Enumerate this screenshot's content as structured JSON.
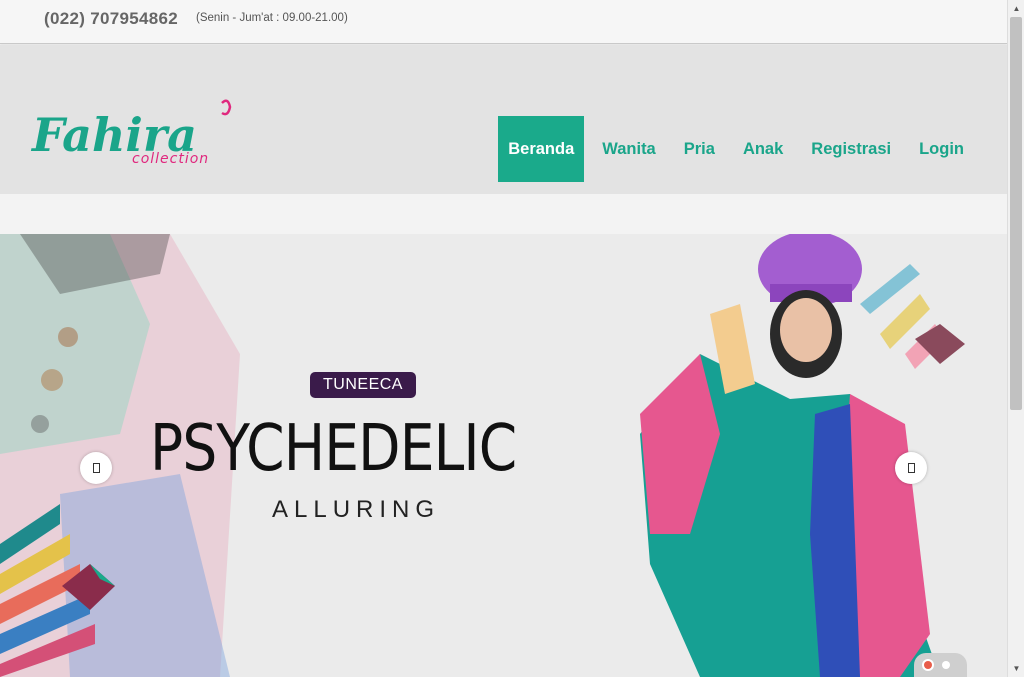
{
  "topbar": {
    "phone": "(022) 707954862",
    "hours": "(Senin - Jum'at : 09.00-21.00)"
  },
  "logo": {
    "name": "Fahira",
    "tagline": "collection"
  },
  "nav": {
    "items": [
      {
        "label": "Beranda",
        "active": true
      },
      {
        "label": "Wanita"
      },
      {
        "label": "Pria"
      },
      {
        "label": "Anak"
      },
      {
        "label": "Registrasi"
      },
      {
        "label": "Login"
      }
    ]
  },
  "slider": {
    "brand": "TUNEECA",
    "headline": "PSYCHEDELIC",
    "subheadline": "ALLURING",
    "prev_icon": "chevron-left-icon",
    "next_icon": "chevron-right-icon",
    "slide_count": 2,
    "active_slide": 1
  },
  "colors": {
    "accent": "#1aaa8b",
    "logo_green": "#1aa58a",
    "logo_pink": "#e0287e"
  }
}
